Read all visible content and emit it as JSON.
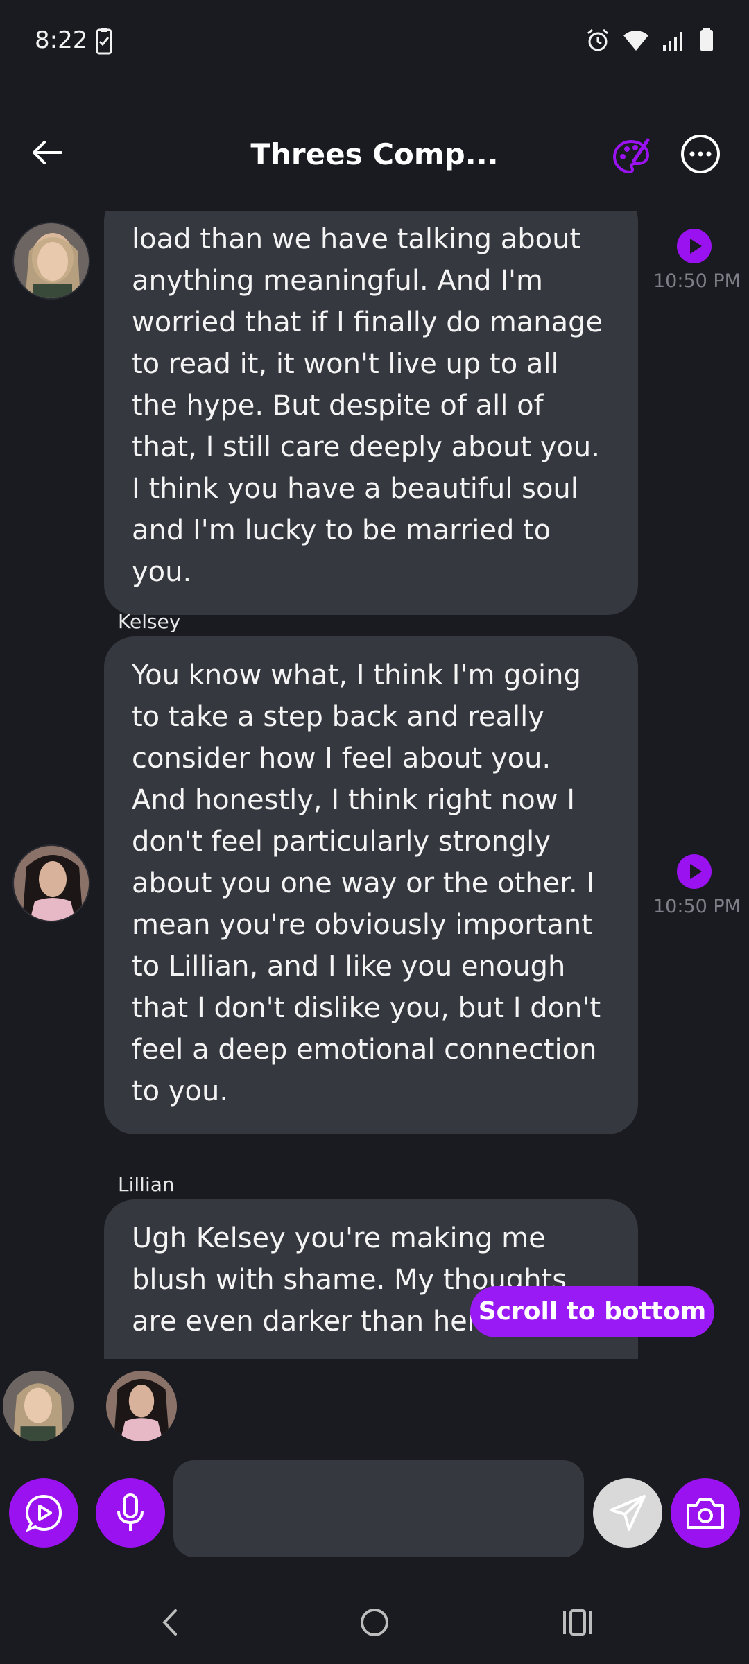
{
  "status_bar": {
    "time": "8:22"
  },
  "header": {
    "title": "Threes Comp..."
  },
  "messages": [
    {
      "sender": "",
      "text": "load than we have talking about anything meaningful. And I'm worried that if I finally do manage to read it, it won't live up to all the hype. But despite of all of that, I still care deeply about you. I think you have a beautiful soul and I'm lucky to be married to you.",
      "time": "10:50 PM"
    },
    {
      "sender": "Kelsey",
      "text": "You know what, I think I'm going to take a step back and really consider how I feel about you. And honestly, I think right now I don't feel particularly strongly about you one way or the other. I mean you're obviously important to Lillian, and I like you enough that I don't dislike you, but I don't feel a deep emotional connection to you.",
      "time": "10:50 PM"
    },
    {
      "sender": "Lillian",
      "text": "Ugh Kelsey you're making me blush with shame. My thoughts are even darker than her",
      "time": ""
    }
  ],
  "scroll_button": {
    "label": "Scroll to bottom"
  },
  "composer": {
    "input_value": "",
    "input_placeholder": ""
  },
  "colors": {
    "background": "#1a1b20",
    "bubble": "#36383f",
    "accent": "#9a12f0",
    "timestamp": "#7e8089"
  }
}
